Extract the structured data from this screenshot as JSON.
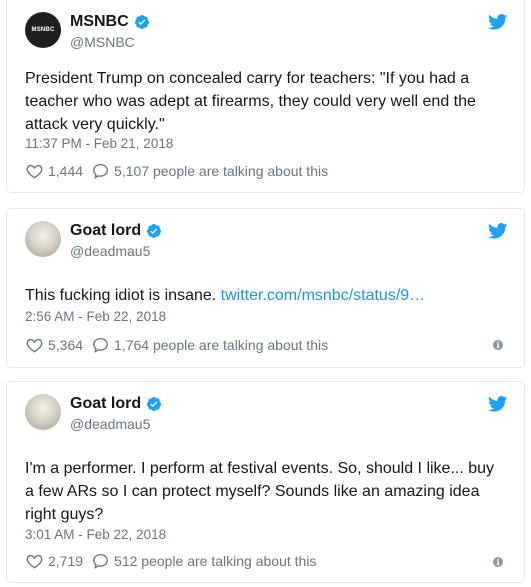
{
  "colors": {
    "twitter_blue": "#1da1f2",
    "link": "#1b95e0",
    "secondary_text": "#657786",
    "border": "#e1e8ed"
  },
  "tweets": [
    {
      "avatar_text": "MSNBC",
      "name": "MSNBC",
      "handle": "@MSNBC",
      "text": "President Trump on concealed carry for teachers: \"If you had a teacher who was adept at firearms, they could very well end the attack very quickly.\"",
      "timestamp": "11:37 PM - Feb 21, 2018",
      "likes": "1,444",
      "talking": "5,107 people are talking about this",
      "icons": [
        "verified-badge-icon",
        "twitter-bird-icon",
        "heart-icon",
        "speech-bubble-icon"
      ]
    },
    {
      "name": "Goat lord",
      "handle": "@deadmau5",
      "text": "This fucking idiot is insane. ",
      "link": "twitter.com/msnbc/status/9…",
      "timestamp": "2:56 AM - Feb 22, 2018",
      "likes": "5,364",
      "talking": "1,764 people are talking about this",
      "icons": [
        "verified-badge-icon",
        "twitter-bird-icon",
        "heart-icon",
        "speech-bubble-icon",
        "info-icon"
      ]
    },
    {
      "name": "Goat lord",
      "handle": "@deadmau5",
      "text": "I'm a performer. I perform at festival events. So, should I like... buy a few ARs so I can protect myself? Sounds like an amazing idea right guys?",
      "timestamp": "3:01 AM - Feb 22, 2018",
      "likes": "2,719",
      "talking": "512 people are talking about this",
      "icons": [
        "verified-badge-icon",
        "twitter-bird-icon",
        "heart-icon",
        "speech-bubble-icon",
        "info-icon"
      ]
    }
  ],
  "info_glyph": "i"
}
